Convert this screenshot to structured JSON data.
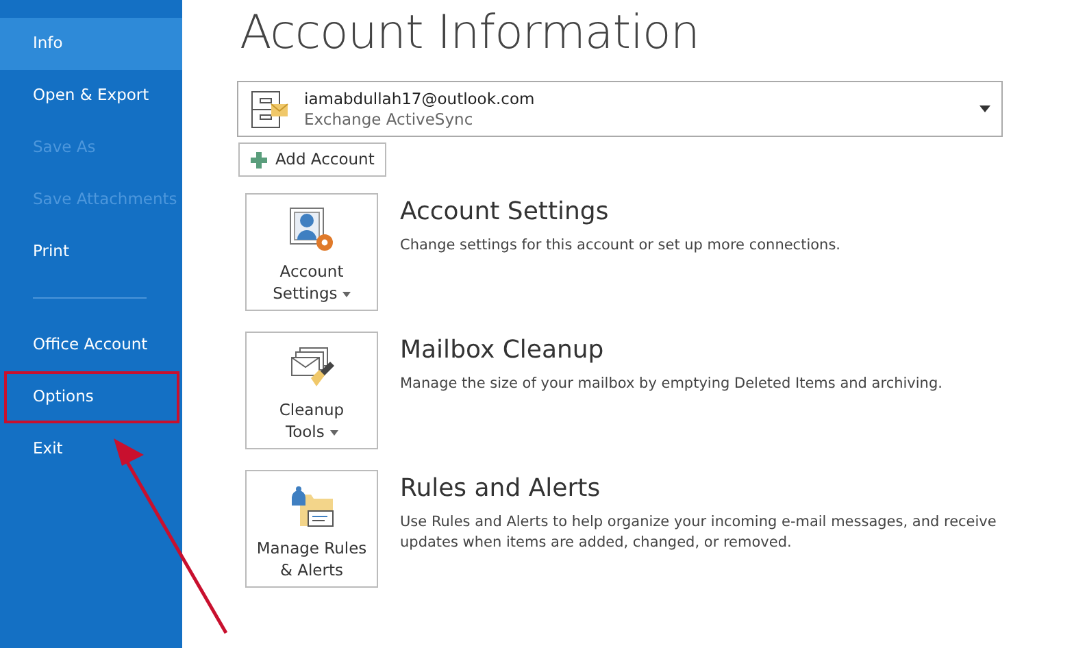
{
  "sidebar": {
    "items": [
      {
        "label": "Info",
        "selected": true,
        "disabled": false,
        "highlighted": false
      },
      {
        "label": "Open & Export",
        "selected": false,
        "disabled": false,
        "highlighted": false
      },
      {
        "label": "Save As",
        "selected": false,
        "disabled": true,
        "highlighted": false
      },
      {
        "label": "Save Attachments",
        "selected": false,
        "disabled": true,
        "highlighted": false
      },
      {
        "label": "Print",
        "selected": false,
        "disabled": false,
        "highlighted": false,
        "divider_after": true
      },
      {
        "label": "Office Account",
        "selected": false,
        "disabled": false,
        "highlighted": false
      },
      {
        "label": "Options",
        "selected": false,
        "disabled": false,
        "highlighted": true
      },
      {
        "label": "Exit",
        "selected": false,
        "disabled": false,
        "highlighted": false
      }
    ]
  },
  "title": "Account Information",
  "account_selector": {
    "email": "iamabdullah17@outlook.com",
    "type": "Exchange ActiveSync"
  },
  "add_account_button": "Add Account",
  "sections": [
    {
      "kind": "account-settings",
      "button_lines": [
        "Account",
        "Settings"
      ],
      "has_menu": true,
      "heading": "Account Settings",
      "description": "Change settings for this account or set up more connections."
    },
    {
      "kind": "cleanup",
      "button_lines": [
        "Cleanup",
        "Tools"
      ],
      "has_menu": true,
      "heading": "Mailbox Cleanup",
      "description": "Manage the size of your mailbox by emptying Deleted Items and archiving."
    },
    {
      "kind": "rules",
      "button_lines": [
        "Manage Rules",
        "& Alerts"
      ],
      "has_menu": false,
      "heading": "Rules and Alerts",
      "description": "Use Rules and Alerts to help organize your incoming e-mail messages, and receive updates when items are added, changed, or removed."
    }
  ]
}
